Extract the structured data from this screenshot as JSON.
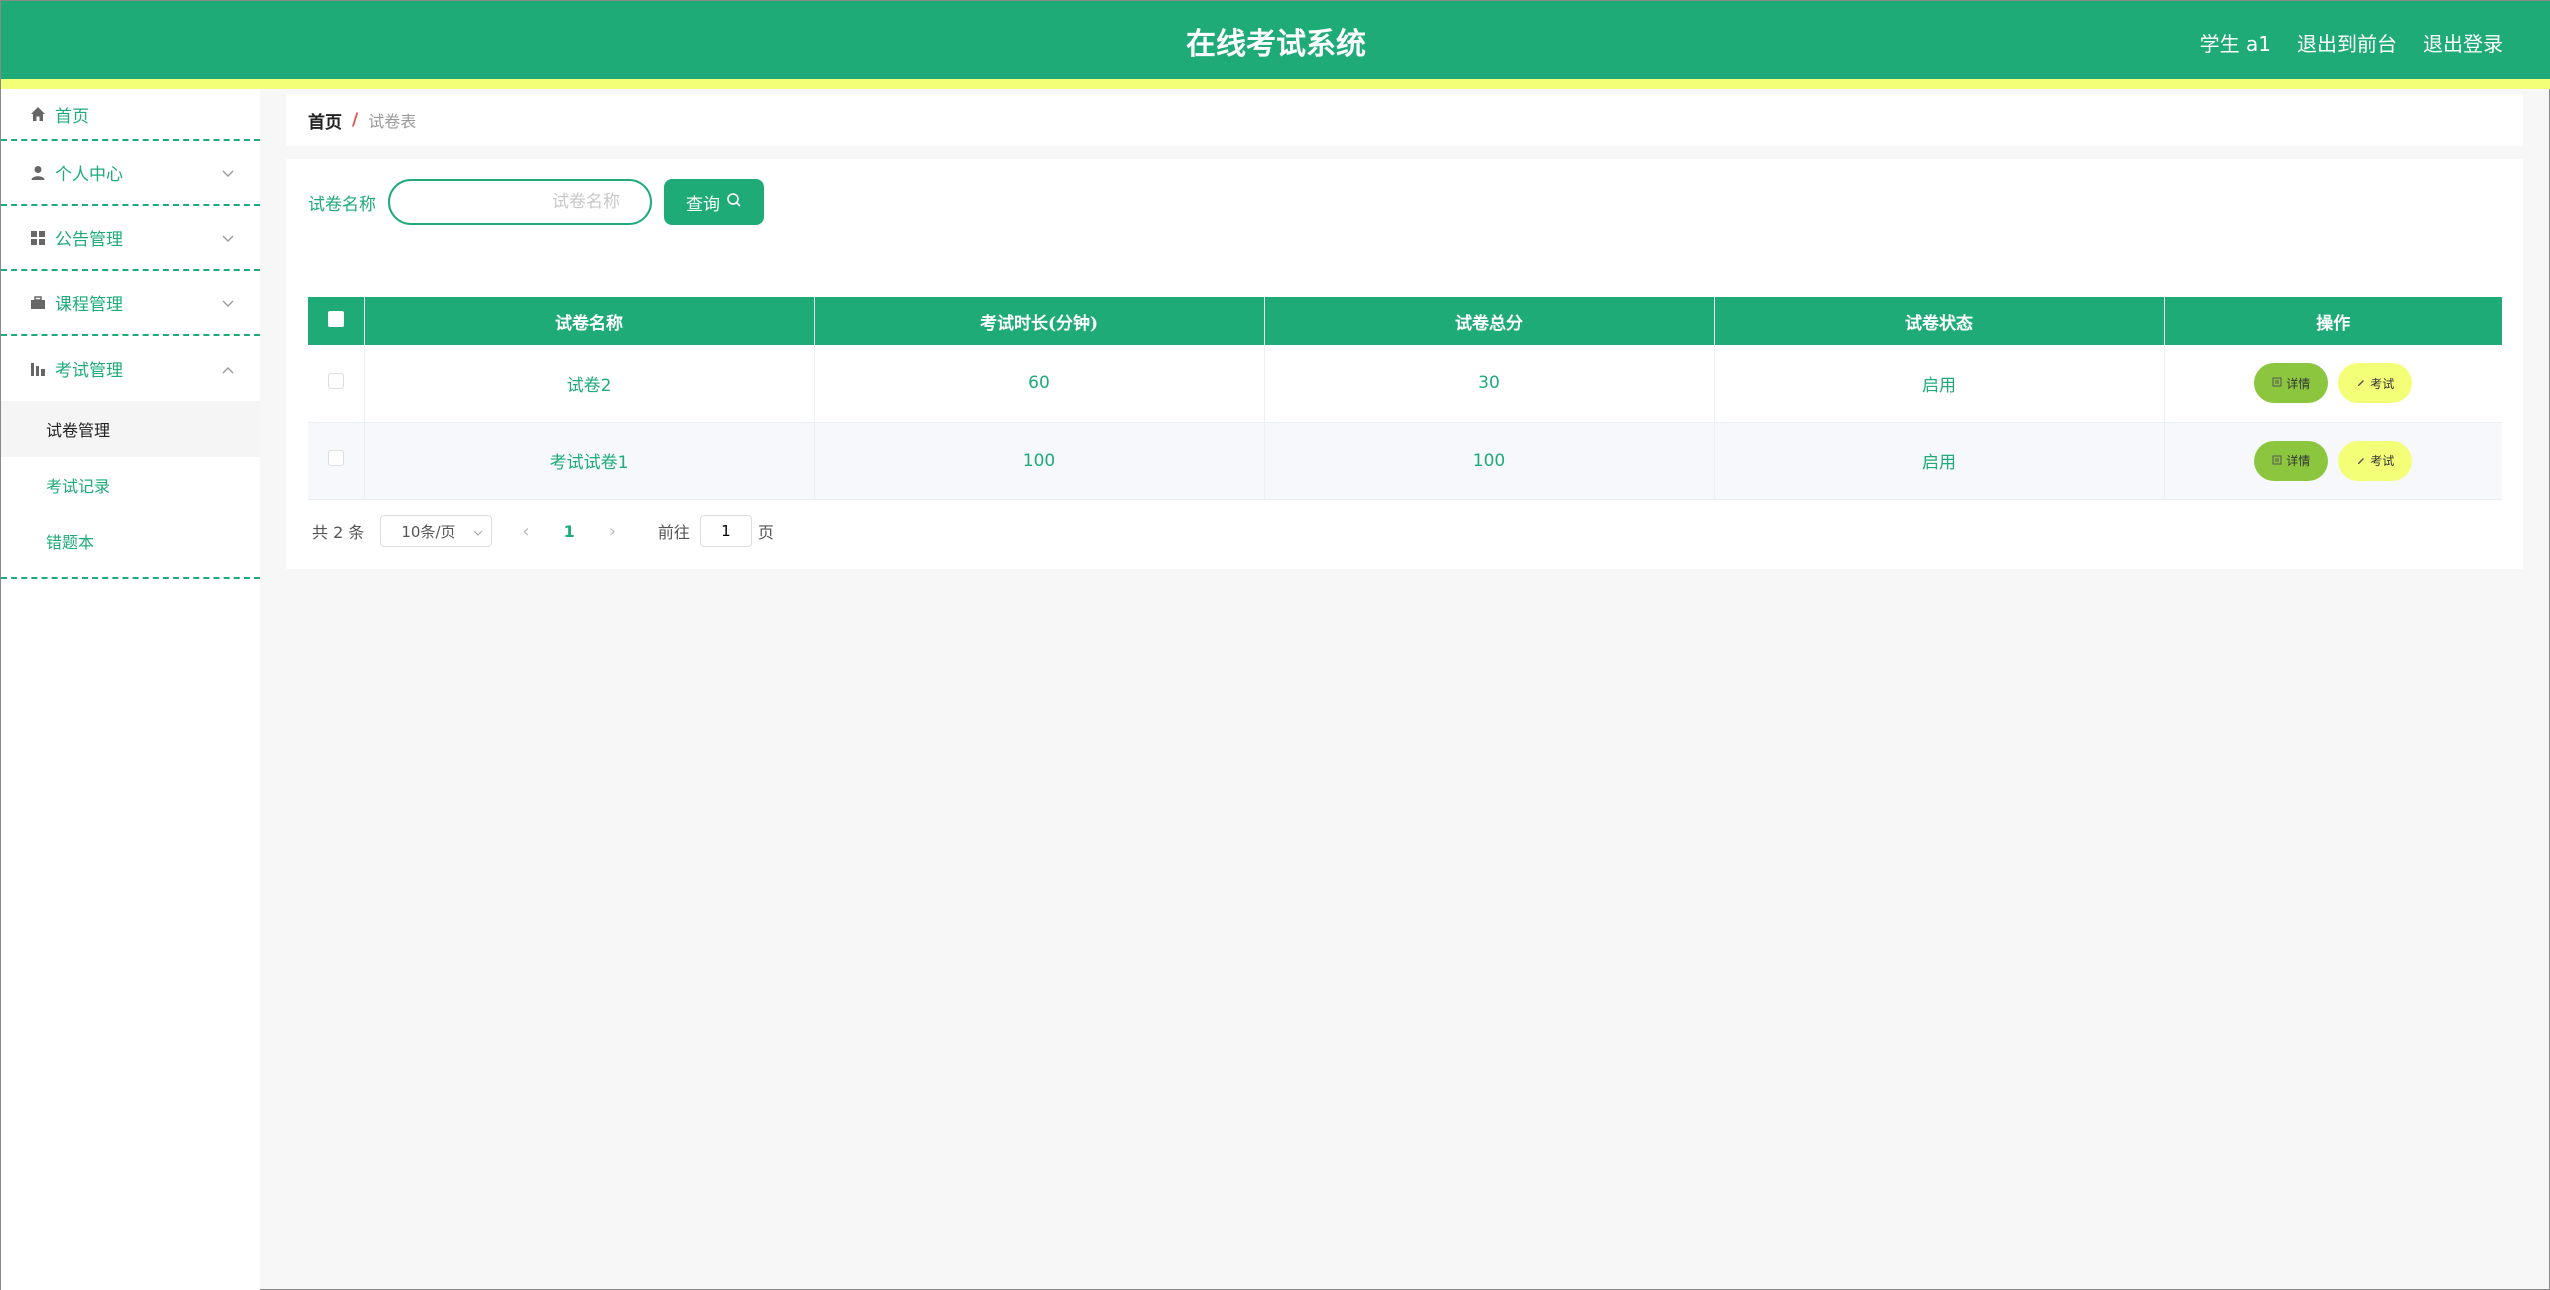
{
  "header": {
    "title": "在线考试系统",
    "user": "学生 a1",
    "back_to_front": "退出到前台",
    "logout": "退出登录"
  },
  "sidebar": {
    "items": [
      {
        "label": "首页",
        "icon": "home-icon"
      },
      {
        "label": "个人中心",
        "icon": "user-icon"
      },
      {
        "label": "公告管理",
        "icon": "grid-icon"
      },
      {
        "label": "课程管理",
        "icon": "briefcase-icon"
      },
      {
        "label": "考试管理",
        "icon": "chart-icon"
      }
    ],
    "submenu": [
      {
        "label": "试卷管理",
        "active": true
      },
      {
        "label": "考试记录"
      },
      {
        "label": "错题本"
      }
    ]
  },
  "breadcrumb": {
    "home": "首页",
    "separator": "/",
    "current": "试卷表"
  },
  "search": {
    "label": "试卷名称",
    "placeholder": "试卷名称",
    "button": "查询"
  },
  "table": {
    "headers": [
      "试卷名称",
      "考试时长(分钟)",
      "试卷总分",
      "试卷状态",
      "操作"
    ],
    "rows": [
      {
        "name": "试卷2",
        "duration": "60",
        "score": "30",
        "status": "启用"
      },
      {
        "name": "考试试卷1",
        "duration": "100",
        "score": "100",
        "status": "启用"
      }
    ],
    "detail_label": "详情",
    "exam_label": "考试"
  },
  "pager": {
    "total": "共 2 条",
    "page_size": "10条/页",
    "current_page": "1",
    "goto_label": "前往",
    "goto_value": "1",
    "page_suffix": "页"
  },
  "colors": {
    "primary": "#1fab78",
    "stripe": "#f4ff78",
    "detail_btn": "#8cc63f",
    "exam_btn": "#f4ff78"
  }
}
